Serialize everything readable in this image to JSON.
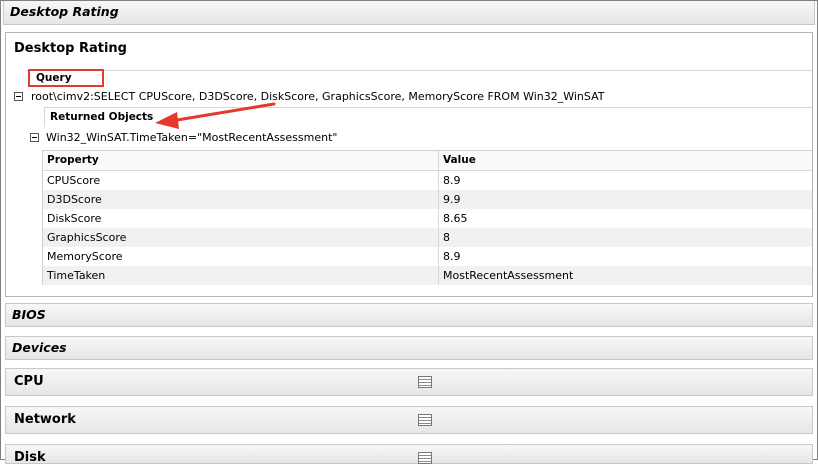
{
  "sections": {
    "top_title": "Desktop Rating",
    "panel_title": "Desktop Rating",
    "query_label": "Query",
    "query_text": "root\\cimv2:SELECT CPUScore, D3DScore, DiskScore, GraphicsScore, MemoryScore FROM Win32_WinSAT",
    "returned_label": "Returned Objects",
    "object_text": "Win32_WinSAT.TimeTaken=\"MostRecentAssessment\"",
    "bios": "BIOS",
    "devices": "Devices",
    "cpu": "CPU",
    "network": "Network",
    "disk": "Disk"
  },
  "table": {
    "headers": [
      "Property",
      "Value"
    ],
    "rows": [
      {
        "property": "CPUScore",
        "value": "8.9"
      },
      {
        "property": "D3DScore",
        "value": "9.9"
      },
      {
        "property": "DiskScore",
        "value": "8.65"
      },
      {
        "property": "GraphicsScore",
        "value": "8"
      },
      {
        "property": "MemoryScore",
        "value": "8.9"
      },
      {
        "property": "TimeTaken",
        "value": "MostRecentAssessment"
      }
    ]
  },
  "colors": {
    "highlight": "#e53935",
    "arrow": "#e5392c"
  },
  "icons": [
    "minus-expander-icon",
    "table-icon",
    "annotation-arrow"
  ]
}
